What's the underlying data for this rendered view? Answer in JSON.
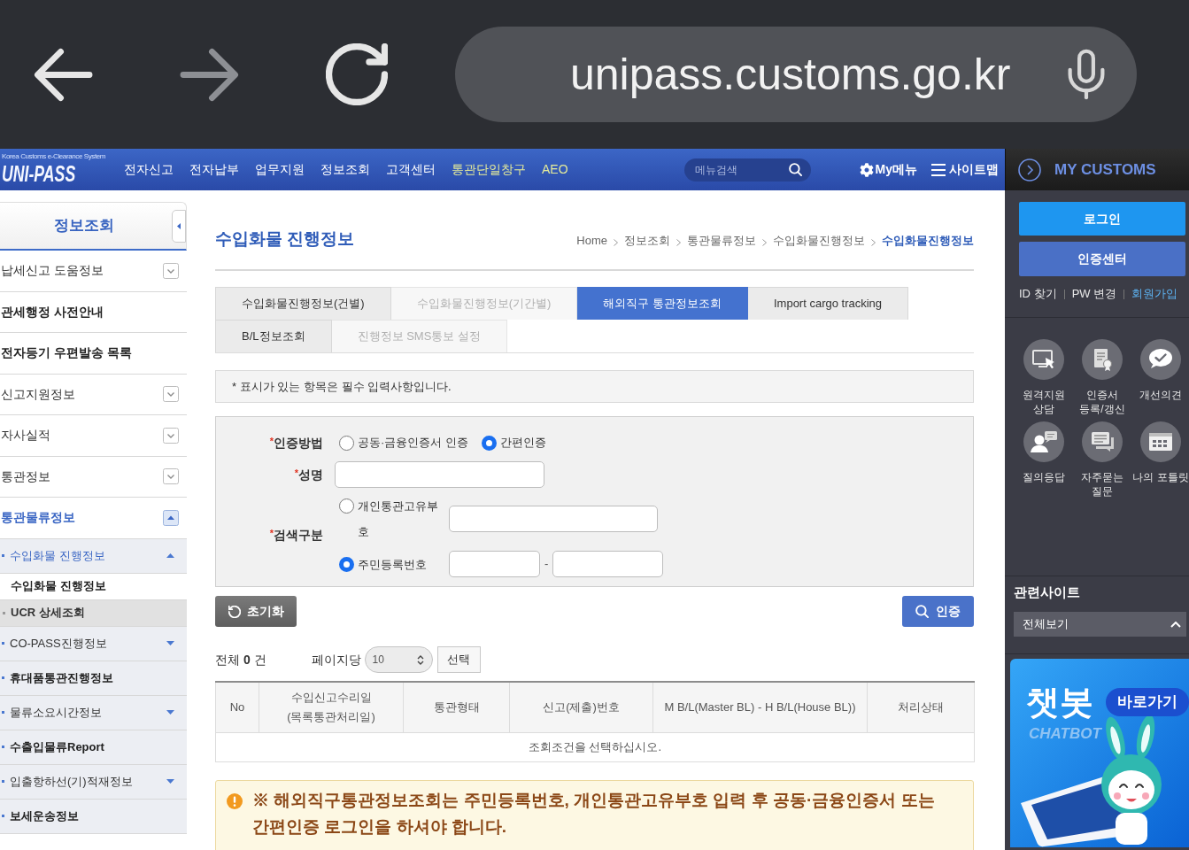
{
  "browser": {
    "url": "unipass.customs.go.kr"
  },
  "header": {
    "logo_tagline": "Korea Customs e-Clearance System",
    "logo_name": "UNI-PASS",
    "nav": [
      {
        "label": "전자신고",
        "color": "#ffffff"
      },
      {
        "label": "전자납부",
        "color": "#ffffff"
      },
      {
        "label": "업무지원",
        "color": "#ffffff"
      },
      {
        "label": "정보조회",
        "color": "#ffffff"
      },
      {
        "label": "고객센터",
        "color": "#ffffff"
      },
      {
        "label": "통관단일창구",
        "color": "#e4ea9a"
      },
      {
        "label": "AEO",
        "color": "#e4ea9a"
      }
    ],
    "search": {
      "placeholder": "메뉴검색"
    },
    "my_menu": "My메뉴",
    "sitemap": "사이트맵"
  },
  "sidebar": {
    "title": "정보조회",
    "items": [
      {
        "label": "납세신고 도움정보",
        "expanded": false
      },
      {
        "label": "관세행정 사전안내"
      },
      {
        "label": "전자등기 우편발송 목록"
      },
      {
        "label": "신고지원정보",
        "expanded": false
      },
      {
        "label": "자사실적",
        "expanded": false
      },
      {
        "label": "통관정보",
        "expanded": false
      },
      {
        "label": "통관물류정보",
        "expanded": true,
        "children": [
          {
            "label": "수입화물 진행정보",
            "expanded": true,
            "children": [
              {
                "label": "수입화물 진행정보",
                "selected": true
              },
              {
                "label": "UCR 상세조회",
                "selected": false
              }
            ]
          },
          {
            "label": "CO-PASS진행정보",
            "expanded": false
          },
          {
            "label": "휴대품통관진행정보"
          },
          {
            "label": "물류소요시간정보",
            "expanded": false
          },
          {
            "label": "수출입물류Report"
          },
          {
            "label": "입출항하선(기)적재정보",
            "expanded": false
          },
          {
            "label": "보세운송정보"
          }
        ]
      }
    ]
  },
  "main": {
    "title": "수입화물 진행정보",
    "breadcrumb": [
      {
        "label": "Home",
        "current": false
      },
      {
        "label": "정보조회",
        "current": false
      },
      {
        "label": "통관물류정보",
        "current": false
      },
      {
        "label": "수입화물진행정보",
        "current": false
      },
      {
        "label": "수입화물진행정보",
        "current": true
      }
    ],
    "tab_rows": [
      [
        {
          "label": "수입화물진행정보(건별)",
          "selected": false,
          "disabled": false
        },
        {
          "label": "수입화물진행정보(기간별)",
          "selected": false,
          "disabled": true
        },
        {
          "label": "해외직구 통관정보조회",
          "selected": true,
          "disabled": false
        },
        {
          "label": "Import cargo tracking",
          "selected": false,
          "disabled": false
        }
      ],
      [
        {
          "label": "B/L정보조회",
          "selected": false,
          "disabled": false
        },
        {
          "label": "진행정보 SMS통보 설정",
          "selected": false,
          "disabled": true
        }
      ]
    ],
    "notice": "* 표시가 있는 항목은 필수 입력사항입니다.",
    "form": {
      "required_mark": "*",
      "fields": [
        {
          "kind": "radio",
          "label": "인증방법",
          "required": true,
          "options": [
            {
              "label": "공동·금융인증서 인증",
              "selected": false
            },
            {
              "label": "간편인증",
              "selected": true
            }
          ]
        },
        {
          "kind": "text",
          "label": "성명",
          "required": true
        },
        {
          "kind": "search",
          "label": "검색구분",
          "required": true,
          "options": [
            {
              "kind": "single",
              "label": "개인통관고유부호",
              "selected": false
            },
            {
              "kind": "split",
              "label": "주민등록번호",
              "selected": true,
              "separator": "-"
            }
          ]
        }
      ]
    },
    "reset_button": "초기화",
    "auth_button": "인증",
    "results": {
      "total": "전체 **0** 건",
      "per_page_label": "페이지당",
      "per_page": "10",
      "select_button": "선택"
    },
    "table": {
      "columns": [
        "No",
        "수입신고수리일 (목록통관처리일)",
        "통관형태",
        "신고(제출)번호",
        "M B/L(Master BL) - H B/L(House BL))",
        "처리상태"
      ],
      "empty_message": "조회조건을 선택하십시오."
    },
    "warning": "※ 해외직구통관정보조회는 주민등록번호, 개인통관고유부호 입력 후 공동·금융인증서 또는 간편인증 로그인을 하셔야 합니다."
  },
  "my_customs": {
    "title": "MY CUSTOMS",
    "login_button": "로그인",
    "cert_button": "인증센터",
    "links": [
      {
        "label": "ID 찾기",
        "color": "#e8e8e8"
      },
      {
        "label": "PW 변경",
        "color": "#e8e8e8"
      },
      {
        "label": "회원가입",
        "color": "#5db3f2"
      }
    ],
    "shortcuts": [
      "원격지원 상담",
      "인증서 등록/갱신",
      "개선의견",
      "질의응답",
      "자주묻는 질문",
      "나의 포틀릿"
    ],
    "related_sites": {
      "title": "관련사이트",
      "selected": "전체보기"
    },
    "banner": {
      "title": "챗봇",
      "subtitle": "CHATBOT",
      "button": "바로가기"
    }
  }
}
